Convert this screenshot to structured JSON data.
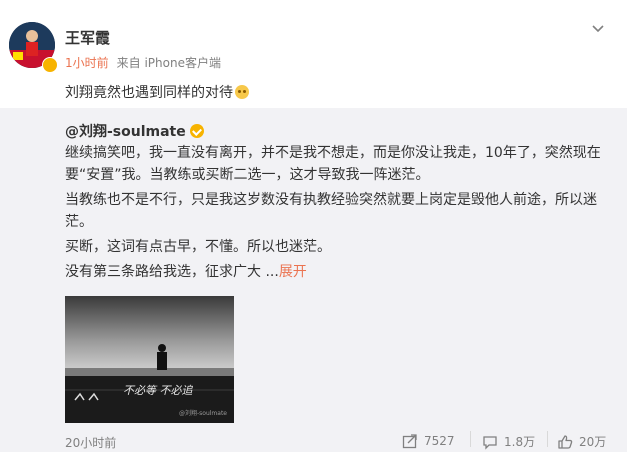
{
  "post": {
    "author": "王军霞",
    "time": "1小时前",
    "source": "来自 iPhone客户端",
    "text": "刘翔竟然也遇到同样的对待",
    "emoji_icon": "grimace-emoji-icon",
    "menu_icon": "chevron-down-icon"
  },
  "repost": {
    "author": "@刘翔-soulmate",
    "verified_icon": "verified-badge-icon",
    "para1": "继续搞笑吧，我一直没有离开，并不是我不想走，而是你没让我走，10年了，突然现在要“安置”我。当教练或买断二选一，这才导致我一阵迷茫。",
    "para2": "当教练也不是不行，只是我这岁数没有执教经验突然就要上岗定是毁他人前途，所以迷茫。",
    "para3": "买断，这词有点古早，不懂。所以也迷茫。",
    "para4": "没有第三条路给我选，征求广大",
    "ellipsis": " ...",
    "expand_label": "展开",
    "image_caption": "不必等 不必追",
    "image_watermark": "@刘翔-soulmate",
    "time": "20小时前",
    "actions": {
      "repost_count": "7527",
      "comment_count": "1.8万",
      "like_count": "20万"
    }
  }
}
